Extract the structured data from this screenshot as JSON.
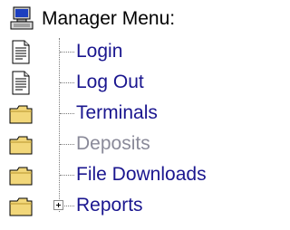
{
  "menu": {
    "title": "Manager Menu:",
    "title_icon": "computer-icon",
    "items": [
      {
        "label": "Login",
        "icon": "document-icon",
        "disabled": false,
        "expandable": false
      },
      {
        "label": "Log Out",
        "icon": "document-icon",
        "disabled": false,
        "expandable": false
      },
      {
        "label": "Terminals",
        "icon": "folder-icon",
        "disabled": false,
        "expandable": false
      },
      {
        "label": "Deposits",
        "icon": "folder-icon",
        "disabled": true,
        "expandable": false
      },
      {
        "label": "File Downloads",
        "icon": "folder-icon",
        "disabled": false,
        "expandable": false
      },
      {
        "label": "Reports",
        "icon": "folder-icon",
        "disabled": false,
        "expandable": true,
        "expanded": false
      }
    ]
  },
  "colors": {
    "link": "#1a168f",
    "disabled": "#8a8a99",
    "folder": "#f2d77a",
    "connector": "#7a7a7a"
  }
}
